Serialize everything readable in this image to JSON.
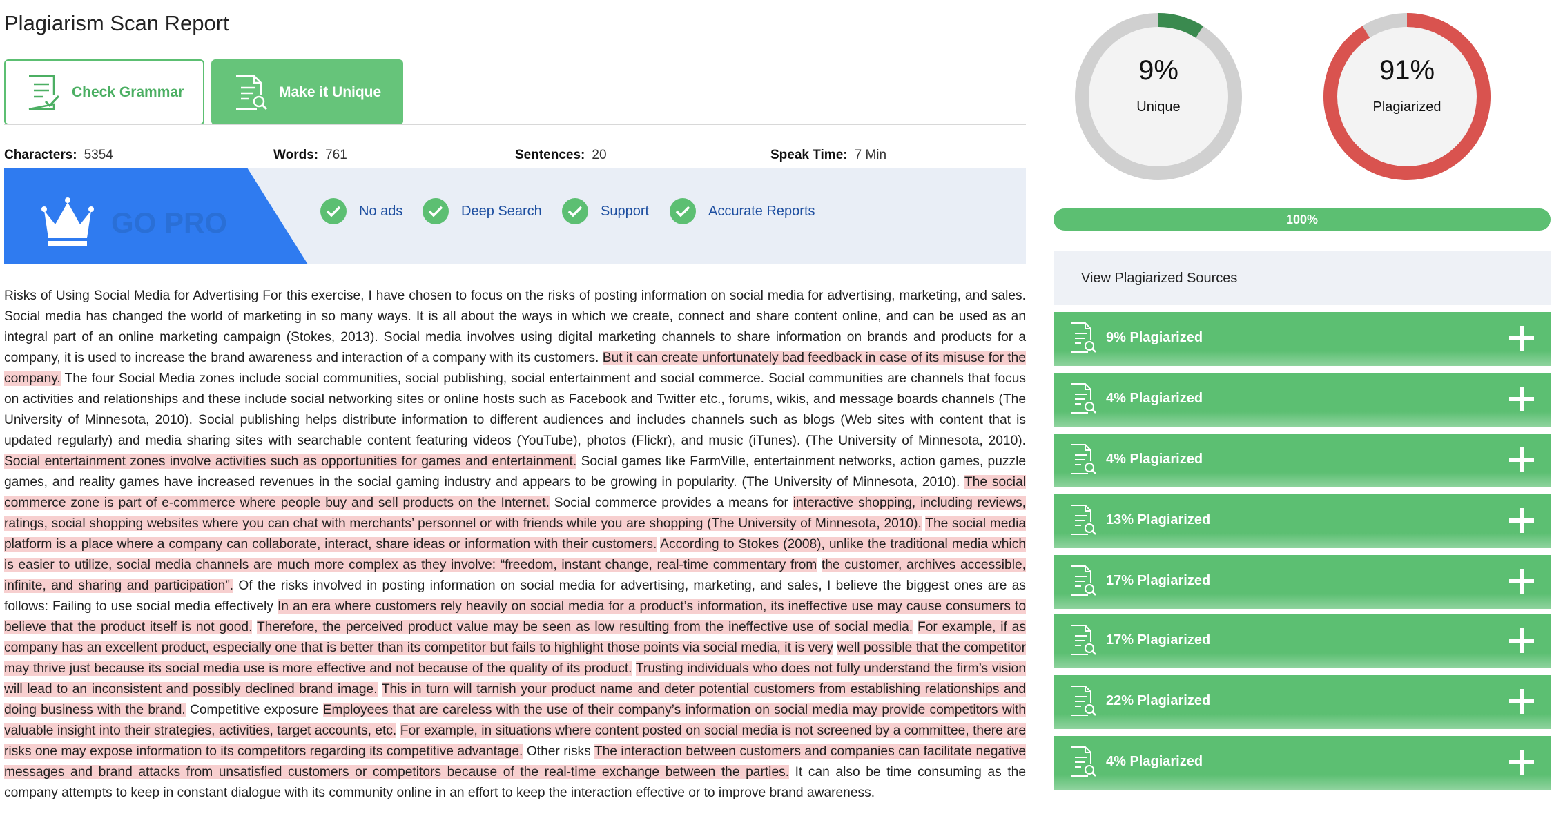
{
  "page_title": "Plagiarism Scan Report",
  "buttons": {
    "grammar": "Check Grammar",
    "unique": "Make it Unique"
  },
  "stats": {
    "characters_label": "Characters:",
    "characters": "5354",
    "words_label": "Words:",
    "words": "761",
    "sentences_label": "Sentences:",
    "sentences": "20",
    "speak_label": "Speak Time:",
    "speak": "7 Min"
  },
  "promo": {
    "go_pro": "GO PRO",
    "features": [
      "No ads",
      "Deep Search",
      "Support",
      "Accurate Reports"
    ]
  },
  "content": [
    {
      "t": "Risks of Using Social Media for Advertising For this exercise, I have chosen to focus on the risks of posting information on social media for advertising, marketing, and sales. Social media has changed the world of marketing in so many ways. It is all about the ways in which we create, connect and share content online, and can be used as an integral part of an online marketing campaign (Stokes, 2013). Social media involves using digital marketing channels to share information on brands and products for a company, it is used to increase the brand awareness and interaction of a company with its customers. ",
      "h": false
    },
    {
      "t": "But it can create unfortunately bad feedback in case of its misuse for the company.",
      "h": true
    },
    {
      "t": " The four Social Media zones include social communities, social publishing, social entertainment and social commerce. Social communities are channels that focus on activities and relationships and these include social networking sites or online hosts such as Facebook and Twitter etc., forums, wikis, and message boards channels (The University of Minnesota, 2010). Social publishing helps distribute information to different audiences and includes channels such as blogs (Web sites with content that is updated regularly) and media sharing sites with searchable content featuring videos (YouTube), photos (Flickr), and music (iTunes). (The University of Minnesota, 2010). ",
      "h": false
    },
    {
      "t": "Social entertainment zones involve activities such as opportunities for games and entertainment.",
      "h": true
    },
    {
      "t": " Social games like FarmVille, entertainment networks, action games, puzzle games, and reality games have increased revenues in the social gaming industry and appears to be growing in popularity. (The University of Minnesota, 2010). ",
      "h": false
    },
    {
      "t": "The social commerce zone is part of e-commerce where people buy and sell products on the Internet.",
      "h": true
    },
    {
      "t": " Social commerce provides a means for ",
      "h": false
    },
    {
      "t": "interactive shopping, including reviews, ratings, social shopping websites where you can chat with merchants’ personnel or with friends while you are shopping (The University of Minnesota, 2010).",
      "h": true
    },
    {
      "t": " ",
      "h": false
    },
    {
      "t": "The social media platform is a place where a company can collaborate, interact, share ideas or information with their customers.",
      "h": true
    },
    {
      "t": " ",
      "h": false
    },
    {
      "t": "According to Stokes (2008), unlike the traditional media which is easier to utilize, social media channels are much more complex as they involve: “freedom, instant change, real-time commentary from",
      "h": true
    },
    {
      "t": " ",
      "h": false
    },
    {
      "t": "the customer, archives accessible, infinite, and sharing and participation”.",
      "h": true
    },
    {
      "t": " Of the risks involved in posting information on social media for advertising, marketing, and sales, I believe the biggest ones are as follows: Failing to use social media effectively ",
      "h": false
    },
    {
      "t": "In an era where customers rely heavily on social media for a product’s information, its ineffective use may cause consumers to believe that the product itself is not good.",
      "h": true
    },
    {
      "t": " ",
      "h": false
    },
    {
      "t": "Therefore, the perceived product value may be seen as low resulting from the ineffective use of social media.",
      "h": true
    },
    {
      "t": " ",
      "h": false
    },
    {
      "t": "For example, if as company has an excellent product, especially one that is better than its competitor but fails to highlight those points via social media, it is very",
      "h": true
    },
    {
      "t": " ",
      "h": false
    },
    {
      "t": "well possible that the competitor may thrive just because its social media use is more effective and not because of the quality of its product.",
      "h": true
    },
    {
      "t": " ",
      "h": false
    },
    {
      "t": "Trusting individuals who does not fully understand the firm’s vision will lead to an inconsistent and possibly declined brand image.",
      "h": true
    },
    {
      "t": " ",
      "h": false
    },
    {
      "t": "This in turn will tarnish your product name and deter potential customers from establishing relationships and doing business with the brand.",
      "h": true
    },
    {
      "t": " Competitive exposure ",
      "h": false
    },
    {
      "t": "Employees that are careless with the use of their company’s information on social media may provide competitors with valuable insight into their strategies, activities, target accounts, etc.",
      "h": true
    },
    {
      "t": " ",
      "h": false
    },
    {
      "t": "For example, in situations where content posted on social media is not screened by a committee, there are risks one may expose information to its competitors regarding its competitive advantage.",
      "h": true
    },
    {
      "t": " Other risks ",
      "h": false
    },
    {
      "t": "The interaction between customers and companies can facilitate negative messages and brand attacks from unsatisfied customers or competitors because of the real-time exchange between the parties.",
      "h": true
    },
    {
      "t": " It can also be time consuming as the company attempts to keep in constant dialogue with its community online in an effort to keep the interaction effective or to improve brand awareness.",
      "h": false
    }
  ],
  "unique": {
    "value": "9%",
    "label": "Unique",
    "fraction": 0.09,
    "color": "#3a8a4f"
  },
  "plagiarized": {
    "value": "91%",
    "label": "Plagiarized",
    "fraction": 0.91,
    "color": "#d9534f"
  },
  "progress": {
    "value": "100%",
    "fraction": 1.0
  },
  "sources_header": "View Plagiarized Sources",
  "sources": [
    "9% Plagiarized",
    "4% Plagiarized",
    "4% Plagiarized",
    "13% Plagiarized",
    "17% Plagiarized",
    "17% Plagiarized",
    "22% Plagiarized",
    "4% Plagiarized"
  ],
  "colors": {
    "accent": "#5cbf72",
    "promo_blue": "#2f7bf0",
    "highlight": "#f7cfcf",
    "ring_track": "#d0d0d0"
  },
  "icons": {
    "grammar": "document-check-icon",
    "unique": "document-search-icon",
    "crown": "crown-icon",
    "check": "check-icon",
    "plus": "plus-icon"
  }
}
